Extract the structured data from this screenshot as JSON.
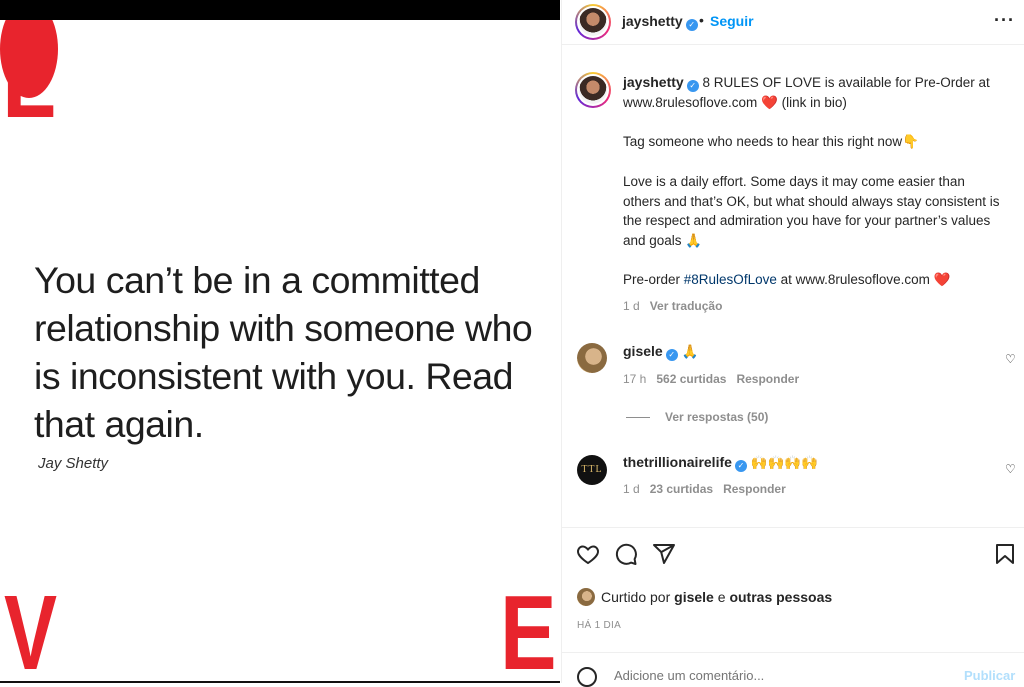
{
  "post_image": {
    "letters": [
      "L",
      "V",
      "E"
    ],
    "quote": "You can’t be in a committed relationship with someone who is inconsistent with you. Read that again.",
    "author": "Jay Shetty"
  },
  "header": {
    "username": "jayshetty",
    "dot": "•",
    "follow_label": "Seguir",
    "more_label": "···"
  },
  "caption": {
    "username": "jayshetty",
    "line1": " 8 RULES OF LOVE is available for Pre-Order at www.8rulesoflove.com ❤️ (link in bio)",
    "line2": "Tag someone who needs to hear this right now👇",
    "line3": "Love is a daily effort. Some days it may come easier than others and that’s OK, but what should always stay consistent is the respect and admiration you have for your partner’s values and goals 🙏",
    "line4_prefix": "Pre-order ",
    "hashtag": "#8RulesOfLove",
    "line4_suffix": " at www.8rulesoflove.com ❤️",
    "time": "1 d",
    "translate": "Ver tradução"
  },
  "comments": [
    {
      "username": "gisele",
      "text": " 🙏",
      "time": "17 h",
      "likes": "562 curtidas",
      "reply": "Responder",
      "view_replies": "Ver respostas (50)"
    },
    {
      "username": "thetrillionairelife",
      "avatar_text": "TTL",
      "text": " 🙌🙌🙌🙌",
      "time": "1 d",
      "likes": "23 curtidas",
      "reply": "Responder"
    }
  ],
  "likes": {
    "prefix": "Curtido por ",
    "user": "gisele",
    "middle": " e ",
    "others": "outras pessoas"
  },
  "time_ago": "HÁ 1 DIA",
  "comment_box": {
    "placeholder": "Adicione um comentário...",
    "post_label": "Publicar"
  },
  "colors": {
    "accent_red": "#e8242d",
    "link_blue": "#0095f6"
  }
}
